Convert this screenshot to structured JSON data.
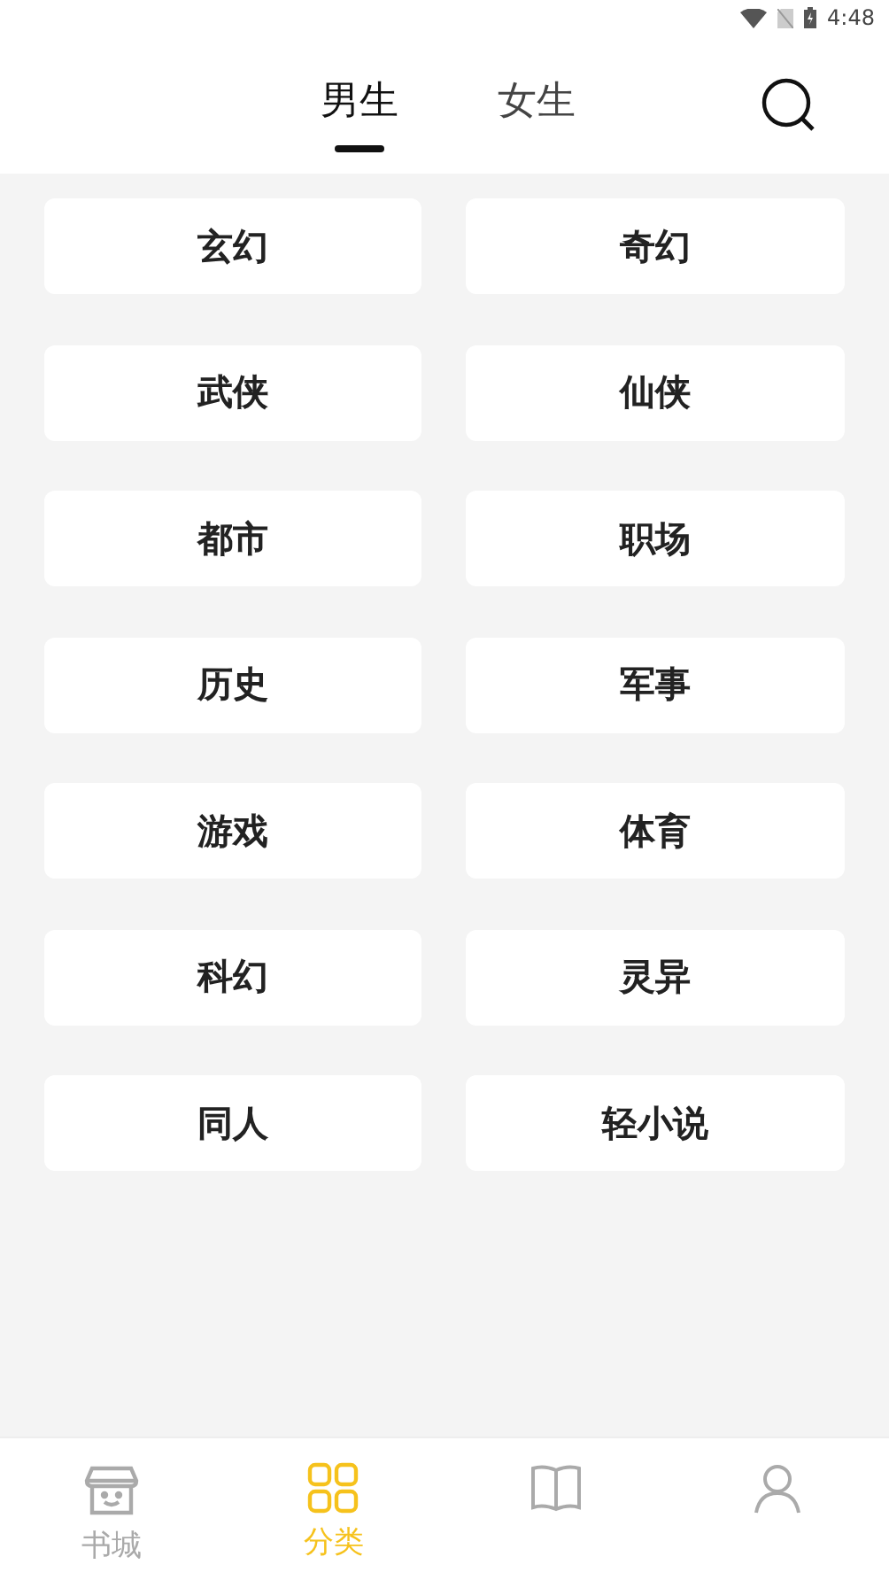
{
  "status_bar": {
    "time": "4:48"
  },
  "tabs": [
    {
      "label": "男生",
      "selected": true
    },
    {
      "label": "女生",
      "selected": false
    }
  ],
  "categories": [
    "玄幻",
    "奇幻",
    "武侠",
    "仙侠",
    "都市",
    "职场",
    "历史",
    "军事",
    "游戏",
    "体育",
    "科幻",
    "灵异",
    "同人",
    "轻小说"
  ],
  "bottom_nav": [
    {
      "kind": "store",
      "label": "书城",
      "selected": false
    },
    {
      "kind": "grid",
      "label": "分类",
      "selected": true
    },
    {
      "kind": "book",
      "selected": false
    },
    {
      "kind": "person",
      "selected": false
    }
  ]
}
